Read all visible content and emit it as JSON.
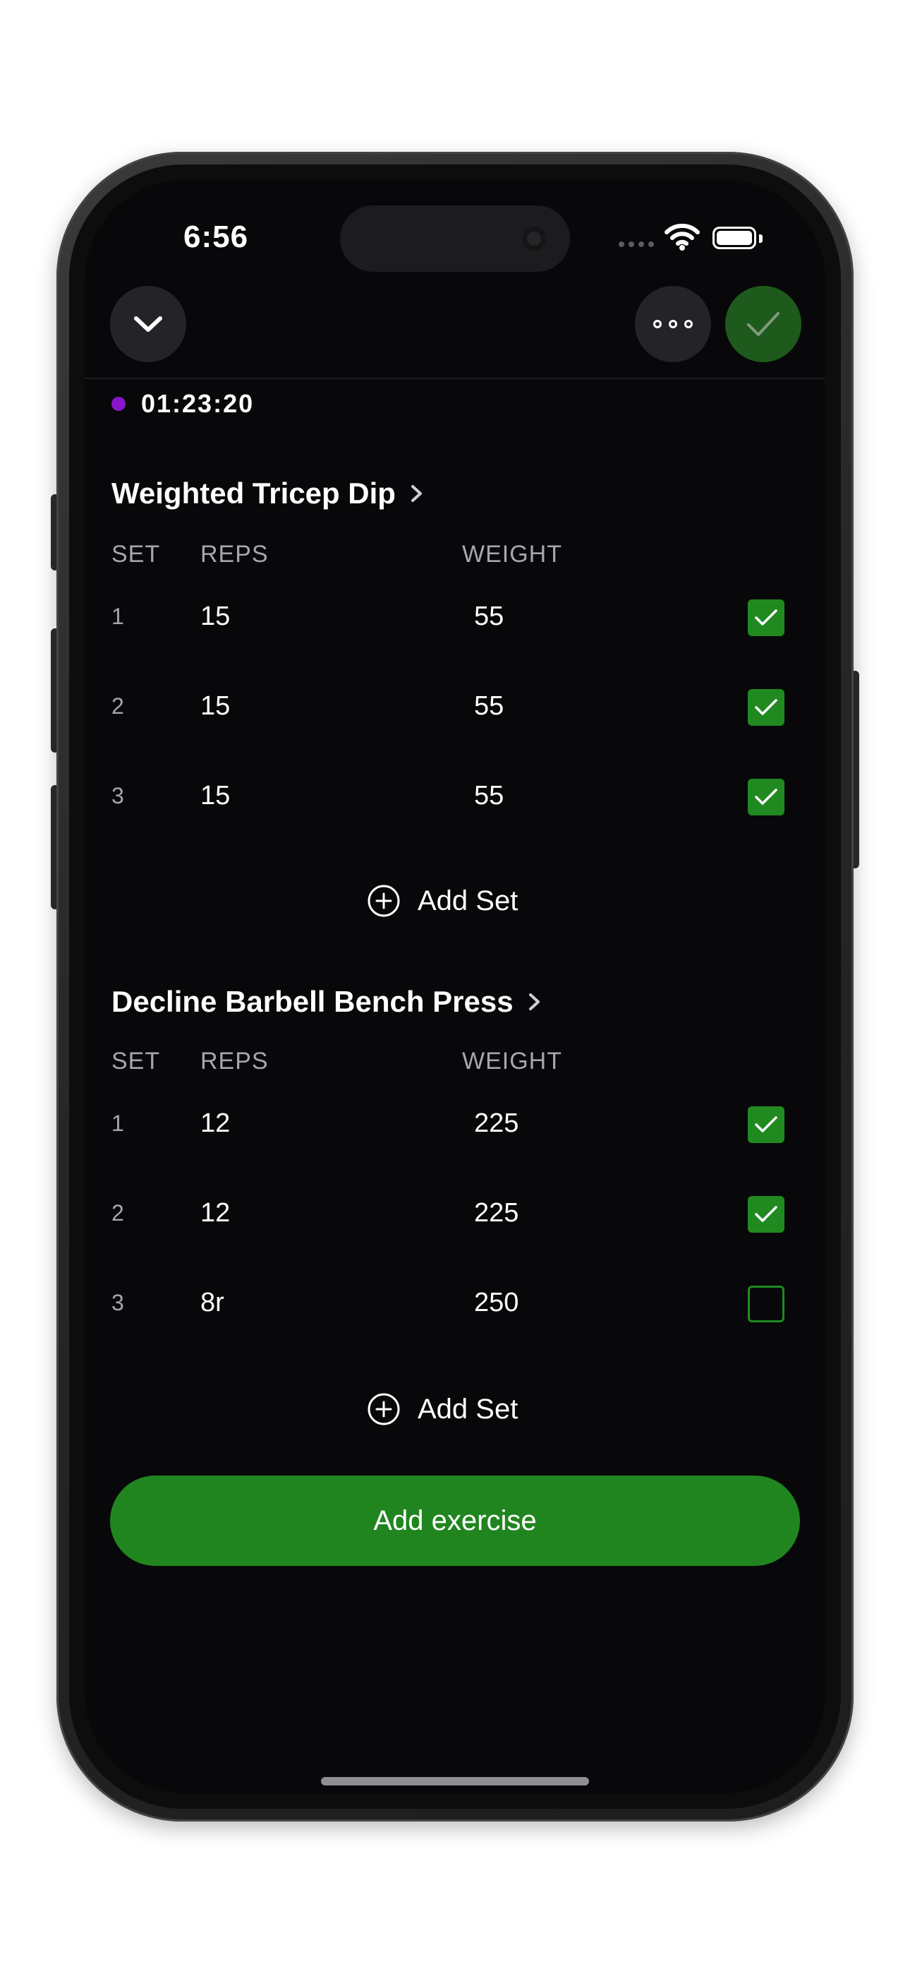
{
  "status_bar": {
    "time": "6:56"
  },
  "timer": {
    "elapsed": "01:23:20",
    "dot_color": "#8a16c9"
  },
  "columns": {
    "set": "SET",
    "reps": "REPS",
    "weight": "WEIGHT"
  },
  "exercises": [
    {
      "name": "Weighted Tricep Dip",
      "sets": [
        {
          "set": "1",
          "reps": "15",
          "weight": "55",
          "done": true
        },
        {
          "set": "2",
          "reps": "15",
          "weight": "55",
          "done": true
        },
        {
          "set": "3",
          "reps": "15",
          "weight": "55",
          "done": true
        }
      ],
      "add_set_label": "Add Set"
    },
    {
      "name": "Decline Barbell Bench Press",
      "sets": [
        {
          "set": "1",
          "reps": "12",
          "weight": "225",
          "done": true
        },
        {
          "set": "2",
          "reps": "12",
          "weight": "225",
          "done": true
        },
        {
          "set": "3",
          "reps": "8r",
          "weight": "250",
          "done": false
        }
      ],
      "add_set_label": "Add Set"
    }
  ],
  "add_exercise_label": "Add exercise",
  "colors": {
    "accent_green": "#208a20",
    "finish_button": "#1e5a1c",
    "background": "#08080b"
  }
}
